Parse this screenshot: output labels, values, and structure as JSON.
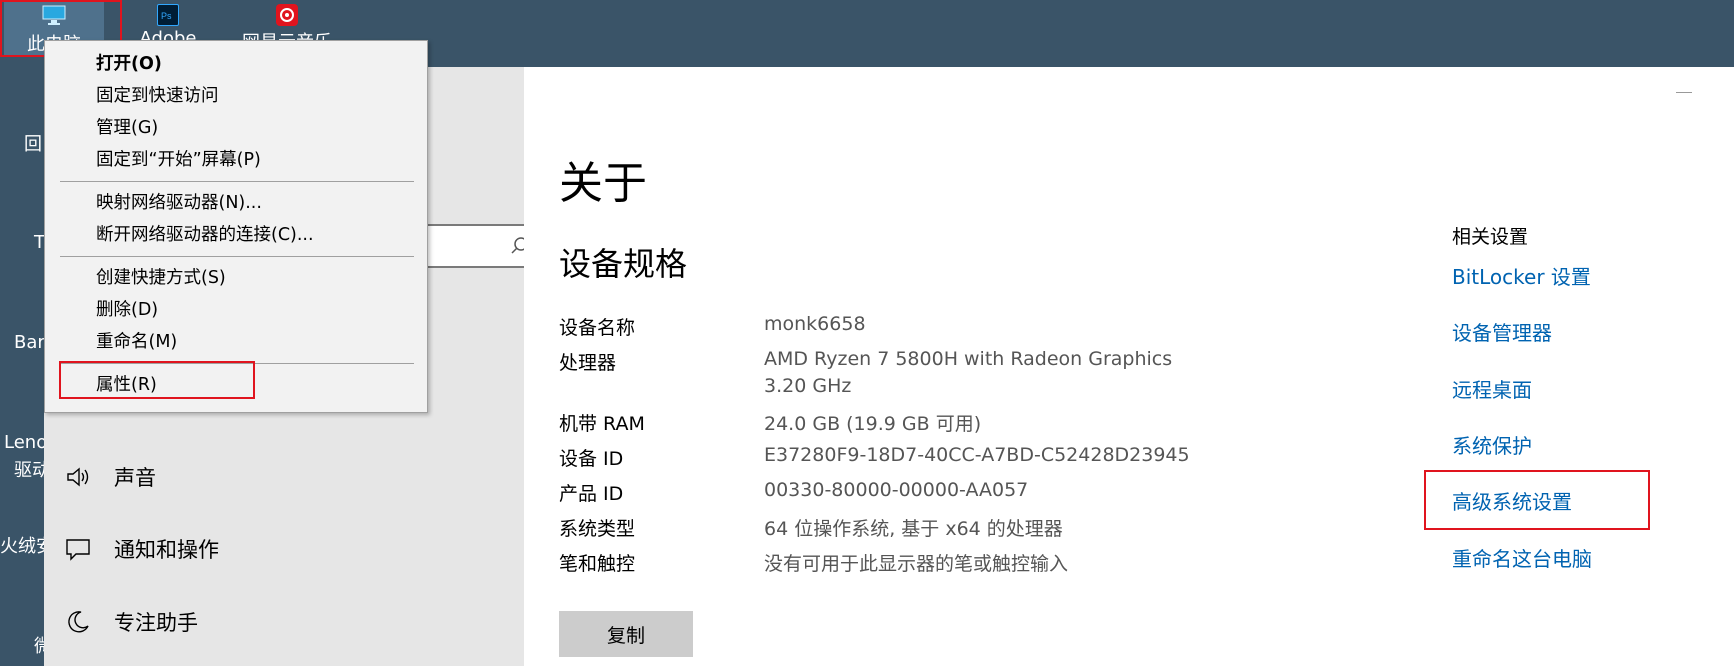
{
  "desktop": {
    "icons": [
      {
        "label": "此电脑",
        "icon": "monitor-icon",
        "color": "#29a8e0"
      },
      {
        "label": "Adobe",
        "icon": "photoshop-shortcut-icon",
        "color": "#001e36"
      },
      {
        "label": "网易云音乐",
        "icon": "netease-music-icon",
        "color": "#e0141e"
      }
    ],
    "edge_labels": [
      "回",
      "T",
      "Bar",
      "Leno",
      "驱动",
      "火绒安",
      "微"
    ]
  },
  "context_menu": {
    "items": [
      {
        "label": "打开(O)",
        "bold": true
      },
      {
        "label": "固定到快速访问"
      },
      {
        "label": "管理(G)"
      },
      {
        "label": "固定到“开始”屏幕(P)"
      },
      {
        "label": "映射网络驱动器(N)..."
      },
      {
        "label": "断开网络驱动器的连接(C)..."
      },
      {
        "label": "创建快捷方式(S)"
      },
      {
        "label": "删除(D)"
      },
      {
        "label": "重命名(M)"
      },
      {
        "label": "属性(R)"
      }
    ]
  },
  "sidebar": {
    "search_icon": "search-icon",
    "items": [
      {
        "label": "声音",
        "icon": "speaker-icon"
      },
      {
        "label": "通知和操作",
        "icon": "notification-icon"
      },
      {
        "label": "专注助手",
        "icon": "moon-icon"
      }
    ]
  },
  "about": {
    "title": "关于",
    "section": "设备规格",
    "specs": [
      {
        "key": "设备名称",
        "value": "monk6658"
      },
      {
        "key": "处理器",
        "value": "AMD Ryzen 7 5800H with Radeon Graphics",
        "value2": "3.20 GHz"
      },
      {
        "key": "机带 RAM",
        "value": "24.0 GB (19.9 GB 可用)"
      },
      {
        "key": "设备 ID",
        "value": "E37280F9-18D7-40CC-A7BD-C52428D23945"
      },
      {
        "key": "产品 ID",
        "value": "00330-80000-00000-AA057"
      },
      {
        "key": "系统类型",
        "value": "64 位操作系统, 基于 x64 的处理器"
      },
      {
        "key": "笔和触控",
        "value": "没有可用于此显示器的笔或触控输入"
      }
    ],
    "copy_button": "复制"
  },
  "related": {
    "title": "相关设置",
    "links": [
      "BitLocker 设置",
      "设备管理器",
      "远程桌面",
      "系统保护",
      "高级系统设置",
      "重命名这台电脑"
    ]
  },
  "colors": {
    "desktop_bg": "#3a5468",
    "link": "#0063b1",
    "highlight_box": "#e0141e",
    "sidebar_bg": "#e6e6e6"
  }
}
